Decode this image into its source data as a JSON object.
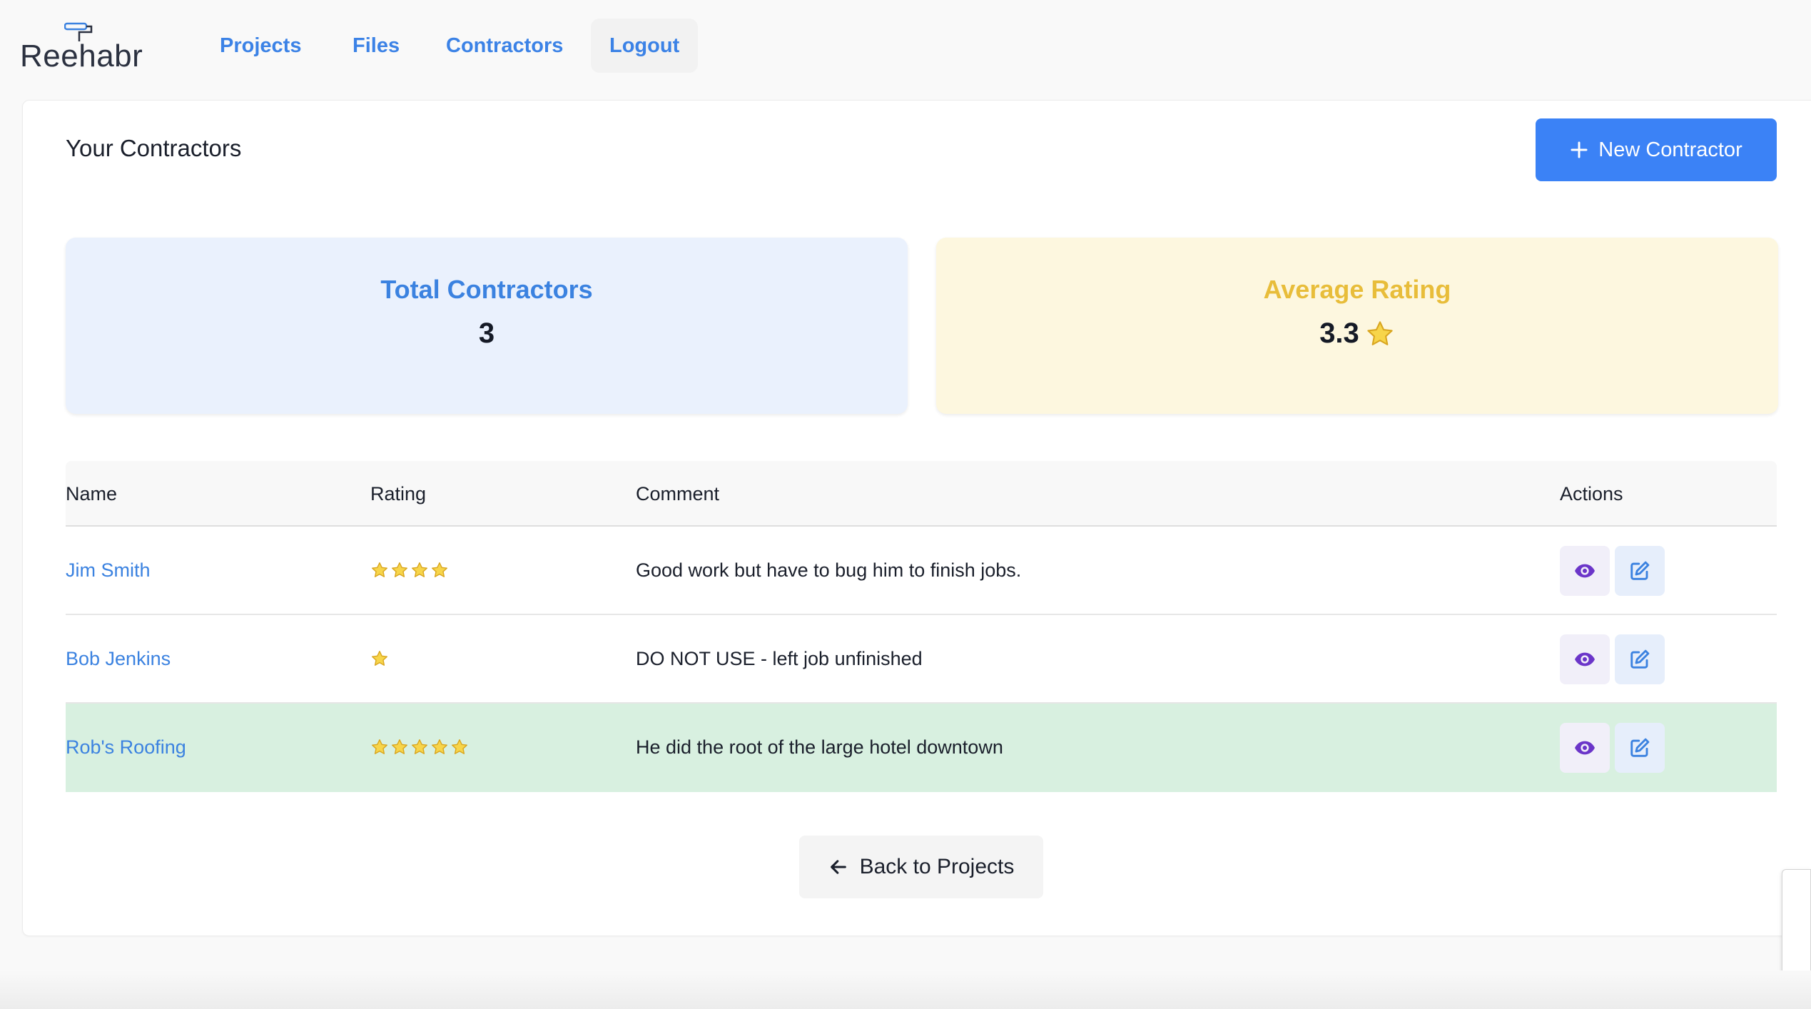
{
  "brand": {
    "logo_text": "Reehabr"
  },
  "nav": {
    "projects": "Projects",
    "files": "Files",
    "contractors": "Contractors",
    "logout": "Logout"
  },
  "page": {
    "title": "Your Contractors",
    "new_button": "New Contractor",
    "back_button": "Back to Projects"
  },
  "stats": {
    "total_label": "Total Contractors",
    "total_value": "3",
    "avg_label": "Average Rating",
    "avg_value": "3.3"
  },
  "table": {
    "headers": {
      "name": "Name",
      "rating": "Rating",
      "comment": "Comment",
      "actions": "Actions"
    },
    "rows": [
      {
        "name": "Jim Smith",
        "rating": 4,
        "comment": "Good work but have to bug him to finish jobs."
      },
      {
        "name": "Bob Jenkins",
        "rating": 1,
        "comment": "DO NOT USE - left job unfinished"
      },
      {
        "name": "Rob's Roofing",
        "rating": 5,
        "comment": "He did the root of the large hotel downtown"
      }
    ]
  },
  "colors": {
    "primary": "#3b82f6",
    "link": "#3b82e0",
    "rating_accent": "#e8bd3a",
    "highlight_row": "#d8f0e0",
    "view_icon": "#6b35c9"
  },
  "icons": {
    "new_button": "plus-icon",
    "back_button": "arrow-left-icon",
    "view_action": "eye-icon",
    "edit_action": "edit-icon",
    "rating": "star-icon"
  }
}
